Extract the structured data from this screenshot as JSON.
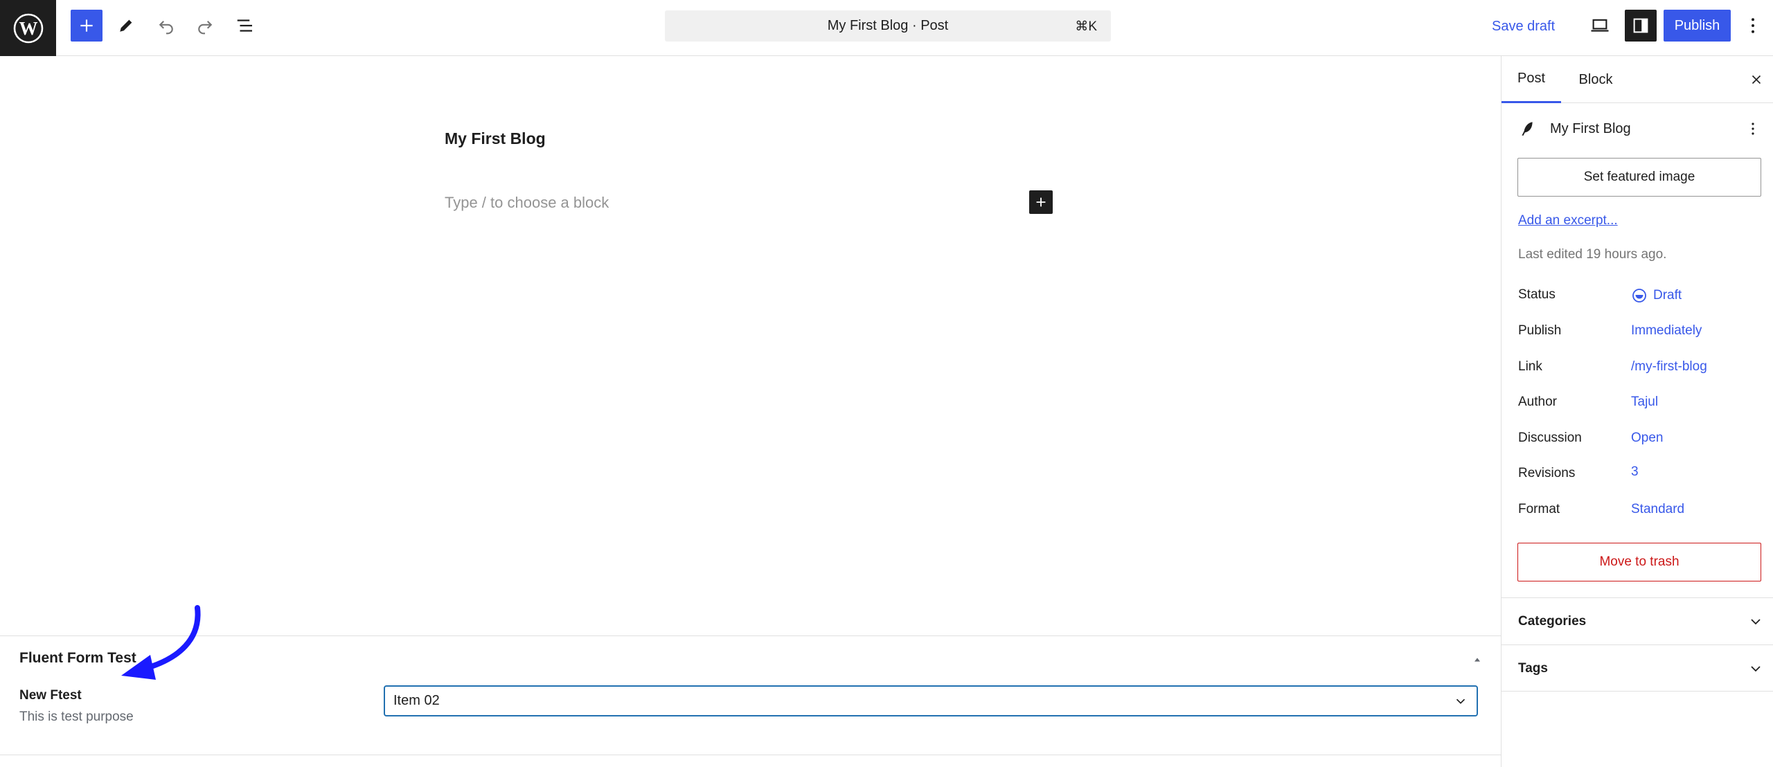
{
  "toolbar": {
    "command_title": "My First Blog · Post",
    "command_shortcut": "⌘K",
    "save_draft_label": "Save draft",
    "publish_label": "Publish"
  },
  "editor": {
    "post_title": "My First Blog",
    "block_placeholder": "Type / to choose a block"
  },
  "metabox": {
    "title": "Fluent Form Test",
    "field_label": "New Ftest",
    "field_help": "This is test purpose",
    "field_value": "Item 02"
  },
  "sidebar": {
    "tabs": [
      {
        "label": "Post"
      },
      {
        "label": "Block"
      }
    ],
    "post_card_title": "My First Blog",
    "featured_image_label": "Set featured image",
    "excerpt_label": "Add an excerpt...",
    "last_edited": "Last edited 19 hours ago.",
    "meta": [
      {
        "label": "Status",
        "value": "Draft"
      },
      {
        "label": "Publish",
        "value": "Immediately"
      },
      {
        "label": "Link",
        "value": "/my-first-blog"
      },
      {
        "label": "Author",
        "value": "Tajul"
      },
      {
        "label": "Discussion",
        "value": "Open"
      },
      {
        "label": "Revisions",
        "value": "3"
      },
      {
        "label": "Format",
        "value": "Standard"
      }
    ],
    "trash_label": "Move to trash",
    "panels": [
      {
        "label": "Categories"
      },
      {
        "label": "Tags"
      }
    ]
  },
  "colors": {
    "accent": "#3858e9",
    "danger": "#cc1818",
    "annotation_arrow": "#1a1aff"
  },
  "icons": {
    "logo": "wordpress-logo-icon",
    "inserter": "plus-icon",
    "tools": "pencil-icon",
    "undo": "undo-icon",
    "redo": "redo-icon",
    "outline": "list-view-icon",
    "preview": "laptop-icon",
    "settings": "sidebar-toggle-icon",
    "more": "vertical-ellipsis-icon"
  }
}
